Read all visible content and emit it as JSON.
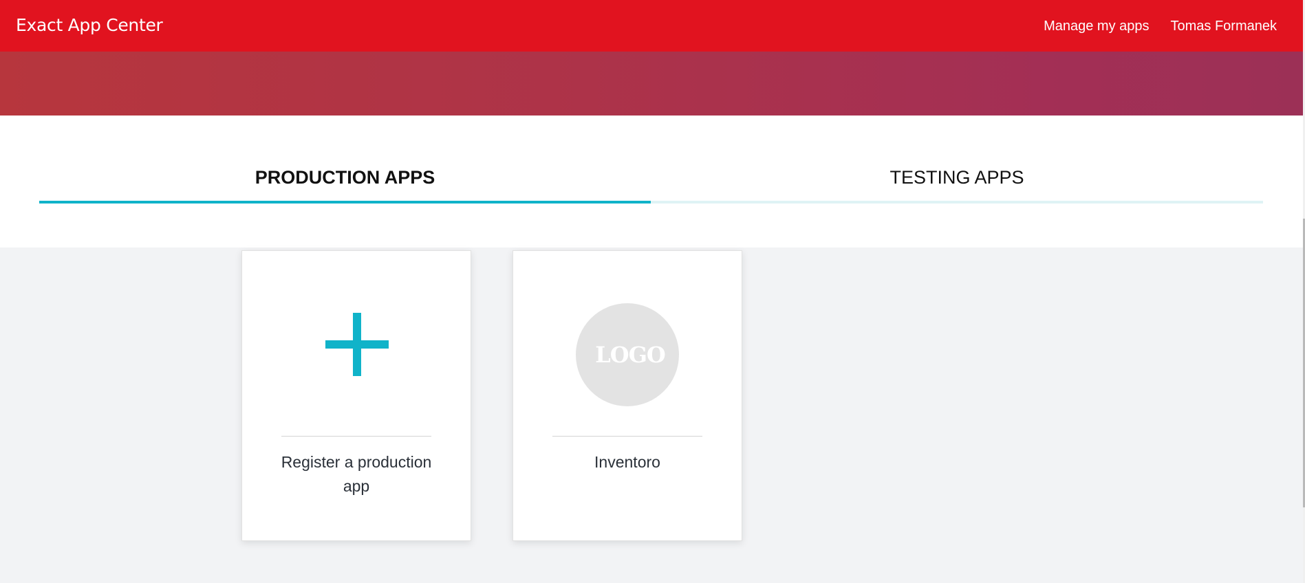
{
  "header": {
    "brand": "Exact App Center",
    "nav": [
      {
        "label": "Manage my apps"
      },
      {
        "label": "Tomas Formanek"
      }
    ],
    "colors": {
      "bar": "#e1131f",
      "text": "#ffffff"
    }
  },
  "tabs": [
    {
      "label": "PRODUCTION APPS",
      "active": true
    },
    {
      "label": "TESTING APPS",
      "active": false
    }
  ],
  "accent_color": "#10b3c9",
  "cards": [
    {
      "icon": "plus-icon",
      "label": "Register a production app"
    },
    {
      "icon": "logo-placeholder",
      "logo_text": "LOGO",
      "label": "Inventoro"
    }
  ]
}
